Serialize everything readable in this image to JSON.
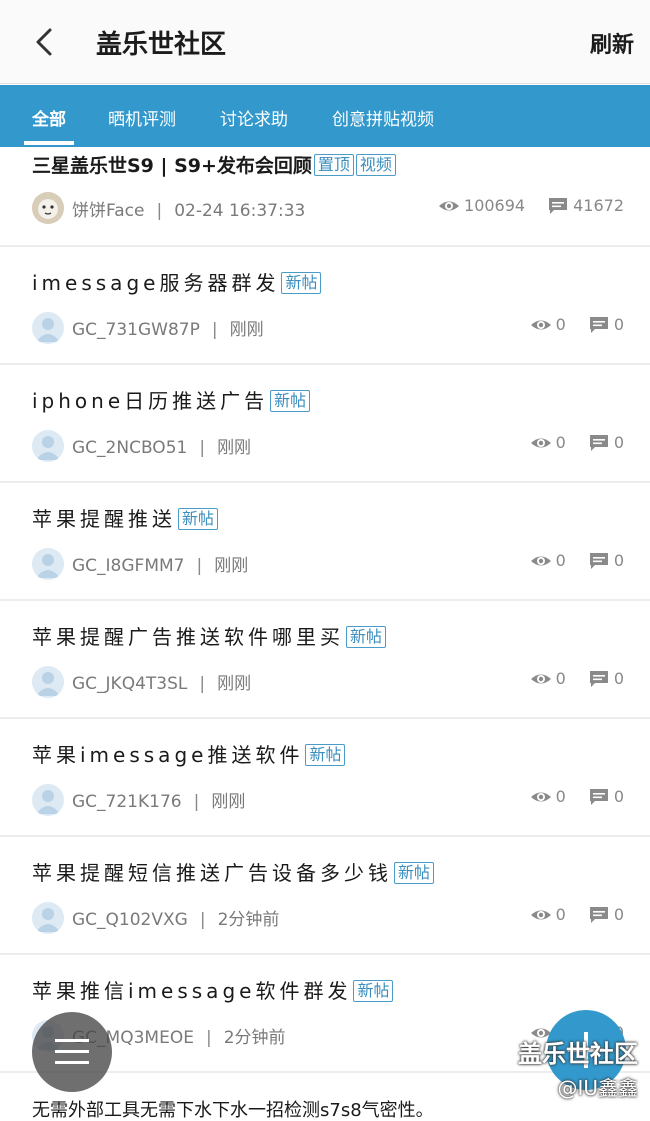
{
  "header": {
    "title": "盖乐世社区",
    "refresh_label": "刷新"
  },
  "tabs": [
    {
      "label": "全部",
      "active": true
    },
    {
      "label": "晒机评测",
      "active": false
    },
    {
      "label": "讨论求助",
      "active": false
    },
    {
      "label": "创意拼贴视频",
      "active": false
    }
  ],
  "posts": [
    {
      "title": "三星盖乐世S9 | S9+发布会回顾",
      "tags": [
        "置顶",
        "视频"
      ],
      "author": "饼饼Face",
      "time": "02-24 16:37:33",
      "views": "100694",
      "comments": "41672"
    },
    {
      "title": "imessage服务器群发",
      "tags": [
        "新帖"
      ],
      "author": "GC_731GW87P",
      "time": "刚刚",
      "views": "0",
      "comments": "0"
    },
    {
      "title": "iphone日历推送广告",
      "tags": [
        "新帖"
      ],
      "author": "GC_2NCBO51",
      "time": "刚刚",
      "views": "0",
      "comments": "0"
    },
    {
      "title": "苹果提醒推送",
      "tags": [
        "新帖"
      ],
      "author": "GC_I8GFMM7",
      "time": "刚刚",
      "views": "0",
      "comments": "0"
    },
    {
      "title": "苹果提醒广告推送软件哪里买",
      "tags": [
        "新帖"
      ],
      "author": "GC_JKQ4T3SL",
      "time": "刚刚",
      "views": "0",
      "comments": "0"
    },
    {
      "title": "苹果imessage推送软件",
      "tags": [
        "新帖"
      ],
      "author": "GC_721K176",
      "time": "刚刚",
      "views": "0",
      "comments": "0"
    },
    {
      "title": "苹果提醒短信推送广告设备多少钱",
      "tags": [
        "新帖"
      ],
      "author": "GC_Q102VXG",
      "time": "2分钟前",
      "views": "0",
      "comments": "0"
    },
    {
      "title": "苹果推信imessage软件群发",
      "tags": [
        "新帖"
      ],
      "author": "GC_MQ3MEOE",
      "time": "2分钟前",
      "views": "0",
      "comments": "0"
    }
  ],
  "last_post_title": "无需外部工具无需下水下水一招检测s7s8气密性。",
  "watermark": {
    "line1": "盖乐世社区",
    "line2": "@IU鑫鑫"
  },
  "colors": {
    "accent": "#3399cc",
    "tag_border": "#4a9dc9"
  }
}
